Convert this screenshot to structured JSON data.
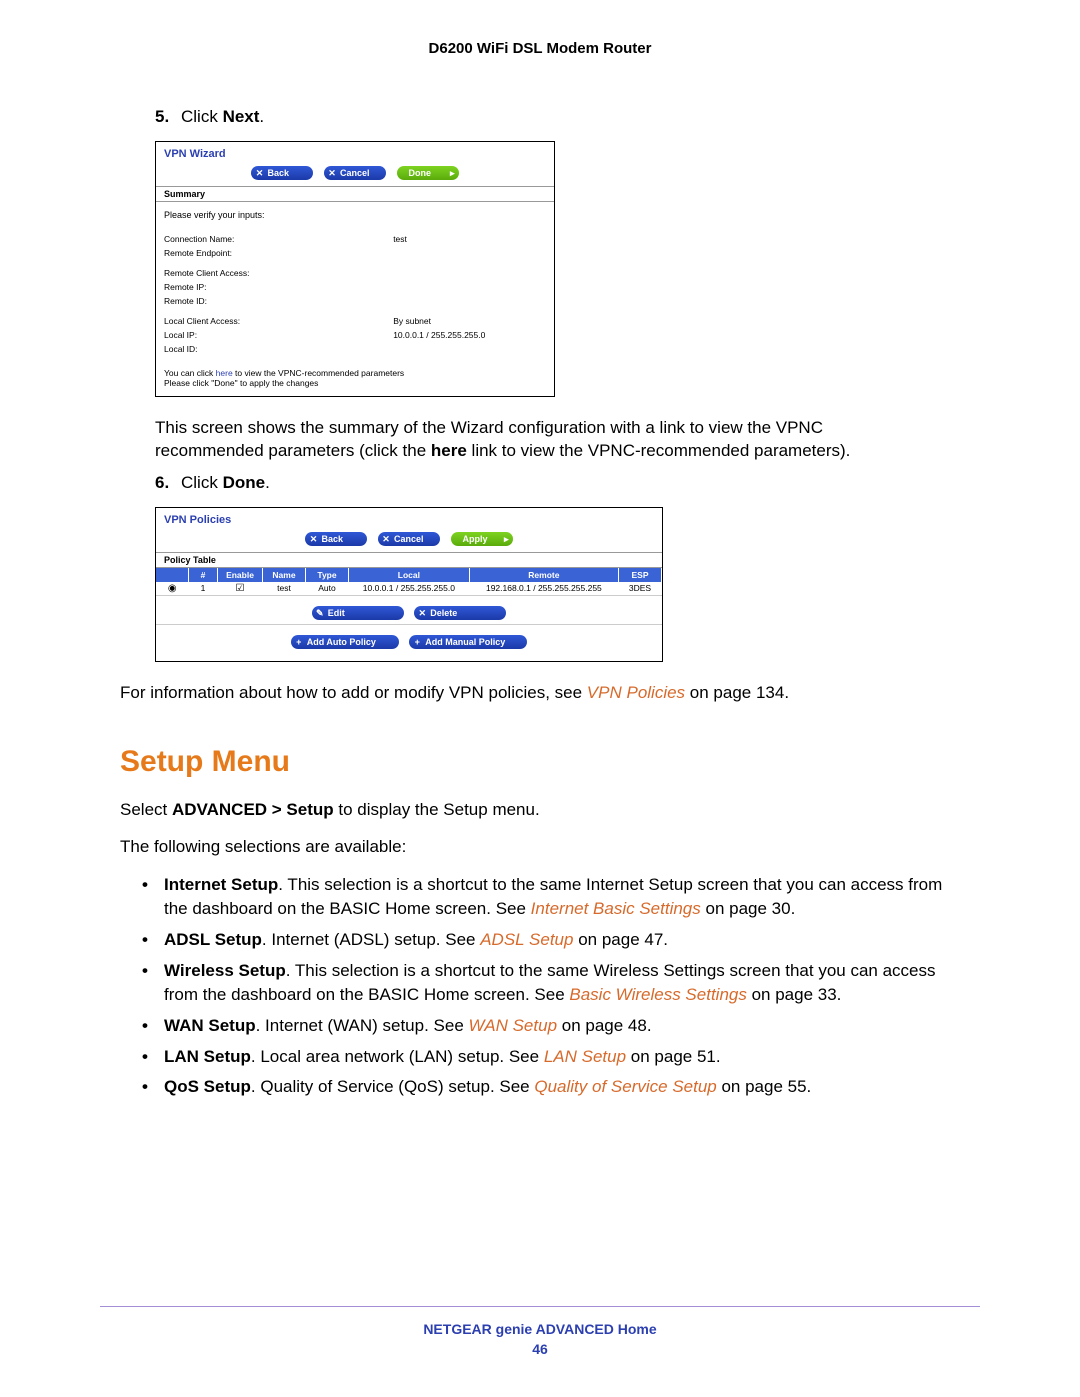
{
  "header": {
    "product": "D6200 WiFi DSL Modem Router"
  },
  "step5": {
    "num": "5.",
    "prefix": "Click ",
    "bold": "Next",
    "suffix": "."
  },
  "wizard": {
    "title": "VPN Wizard",
    "buttons": {
      "back": "Back",
      "cancel": "Cancel",
      "done": "Done"
    },
    "summary_label": "Summary",
    "verify_label": "Please verify your inputs:",
    "rows": {
      "conn_name_k": "Connection Name:",
      "conn_name_v": "test",
      "remote_ep_k": "Remote Endpoint:",
      "remote_ep_v": "",
      "rca_k": "Remote Client Access:",
      "rca_v": "",
      "rip_k": "Remote IP:",
      "rip_v": "",
      "rid_k": "Remote ID:",
      "rid_v": "",
      "lca_k": "Local Client Access:",
      "lca_v": "By subnet",
      "lip_k": "Local IP:",
      "lip_v": "10.0.0.1 / 255.255.255.0",
      "lid_k": "Local ID:",
      "lid_v": ""
    },
    "footer_line1a": "You can click ",
    "footer_line1_link": "here",
    "footer_line1b": " to view the VPNC-recommended parameters",
    "footer_line2": "Please click \"Done\" to apply the changes"
  },
  "after_wizard_para": {
    "text_a": "This screen shows the summary of the Wizard configuration with a link to view the VPNC recommended parameters (click the ",
    "bold": "here",
    "text_b": " link to view the VPNC-recommended parameters)."
  },
  "step6": {
    "num": "6.",
    "prefix": "Click ",
    "bold": "Done",
    "suffix": "."
  },
  "policies": {
    "title": "VPN Policies",
    "buttons": {
      "back": "Back",
      "cancel": "Cancel",
      "apply": "Apply",
      "edit": "Edit",
      "delete": "Delete",
      "add_auto": "Add Auto Policy",
      "add_manual": "Add Manual Policy"
    },
    "policy_table_label": "Policy Table",
    "cols": {
      "blank": "",
      "num": "#",
      "enable": "Enable",
      "name": "Name",
      "type": "Type",
      "local": "Local",
      "remote": "Remote",
      "esp": "ESP"
    },
    "row": {
      "num": "1",
      "name": "test",
      "type": "Auto",
      "local": "10.0.0.1 / 255.255.255.0",
      "remote": "192.168.0.1 / 255.255.255.255",
      "esp": "3DES"
    }
  },
  "after_policies_para": {
    "text_a": "For information about how to add or modify VPN policies, see ",
    "link": "VPN Policies",
    "text_b": " on page 134."
  },
  "heading": "Setup Menu",
  "intro1_a": "Select ",
  "intro1_bold": "ADVANCED > Setup",
  "intro1_b": " to display the Setup menu.",
  "intro2": "The following selections are available:",
  "bullets": {
    "b1": {
      "bold": "Internet Setup",
      "rest_a": ". This selection is a shortcut to the same Internet Setup screen that you can access from the dashboard on the BASIC Home screen. See ",
      "link": "Internet Basic Settings",
      "rest_b": " on page 30."
    },
    "b2": {
      "bold": "ADSL Setup",
      "rest_a": ". Internet (ADSL) setup. See ",
      "link": "ADSL Setup",
      "rest_b": " on page 47."
    },
    "b3": {
      "bold": "Wireless Setup",
      "rest_a": ". This selection is a shortcut to the same Wireless Settings screen that you can access from the dashboard on the BASIC Home screen. See ",
      "link": "Basic Wireless Settings",
      "rest_b": " on page 33."
    },
    "b4": {
      "bold": "WAN Setup",
      "rest_a": ". Internet (WAN) setup. See ",
      "link": "WAN Setup",
      "rest_b": " on page 48."
    },
    "b5": {
      "bold": "LAN Setup",
      "rest_a": ". Local area network (LAN) setup. See ",
      "link": "LAN Setup",
      "rest_b": " on page 51."
    },
    "b6": {
      "bold": "QoS Setup",
      "rest_a": ". Quality of Service (QoS) setup. See ",
      "link": "Quality of Service Setup",
      "rest_b": " on page 55."
    }
  },
  "footer": {
    "text": "NETGEAR genie ADVANCED Home",
    "page": "46"
  }
}
